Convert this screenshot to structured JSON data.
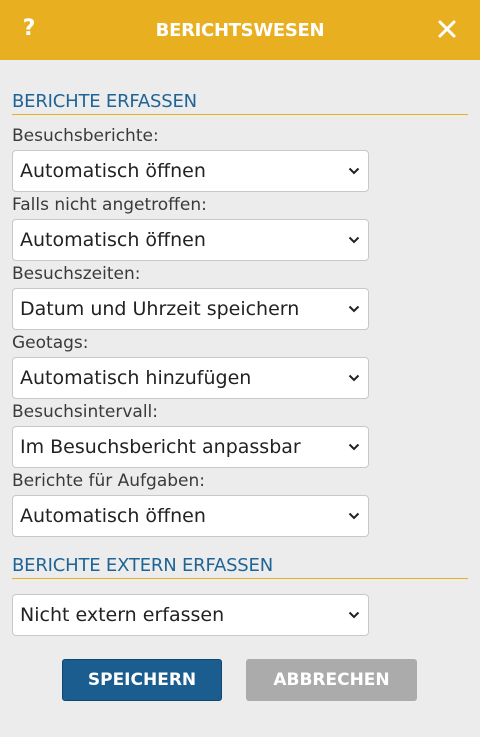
{
  "header": {
    "help_label": "?",
    "title": "BERICHTSWESEN",
    "close_icon": "close-icon"
  },
  "sections": [
    {
      "title": "BERICHTE ERFASSEN",
      "fields": [
        {
          "label": "Besuchsberichte:",
          "value": "Automatisch öffnen"
        },
        {
          "label": "Falls nicht angetroffen:",
          "value": "Automatisch öffnen"
        },
        {
          "label": "Besuchszeiten:",
          "value": "Datum und Uhrzeit speichern"
        },
        {
          "label": "Geotags:",
          "value": "Automatisch hinzufügen"
        },
        {
          "label": "Besuchsintervall:",
          "value": "Im Besuchsbericht anpassbar"
        },
        {
          "label": "Berichte für Aufgaben:",
          "value": "Automatisch öffnen"
        }
      ]
    },
    {
      "title": "BERICHTE EXTERN ERFASSEN",
      "fields": [
        {
          "label": "",
          "value": "Nicht extern erfassen"
        }
      ]
    }
  ],
  "buttons": {
    "save": "SPEICHERN",
    "cancel": "ABBRECHEN"
  },
  "colors": {
    "header": "#e8b021",
    "section_title": "#1e6496",
    "save_button": "#1a5d8e",
    "cancel_button": "#ababab"
  }
}
